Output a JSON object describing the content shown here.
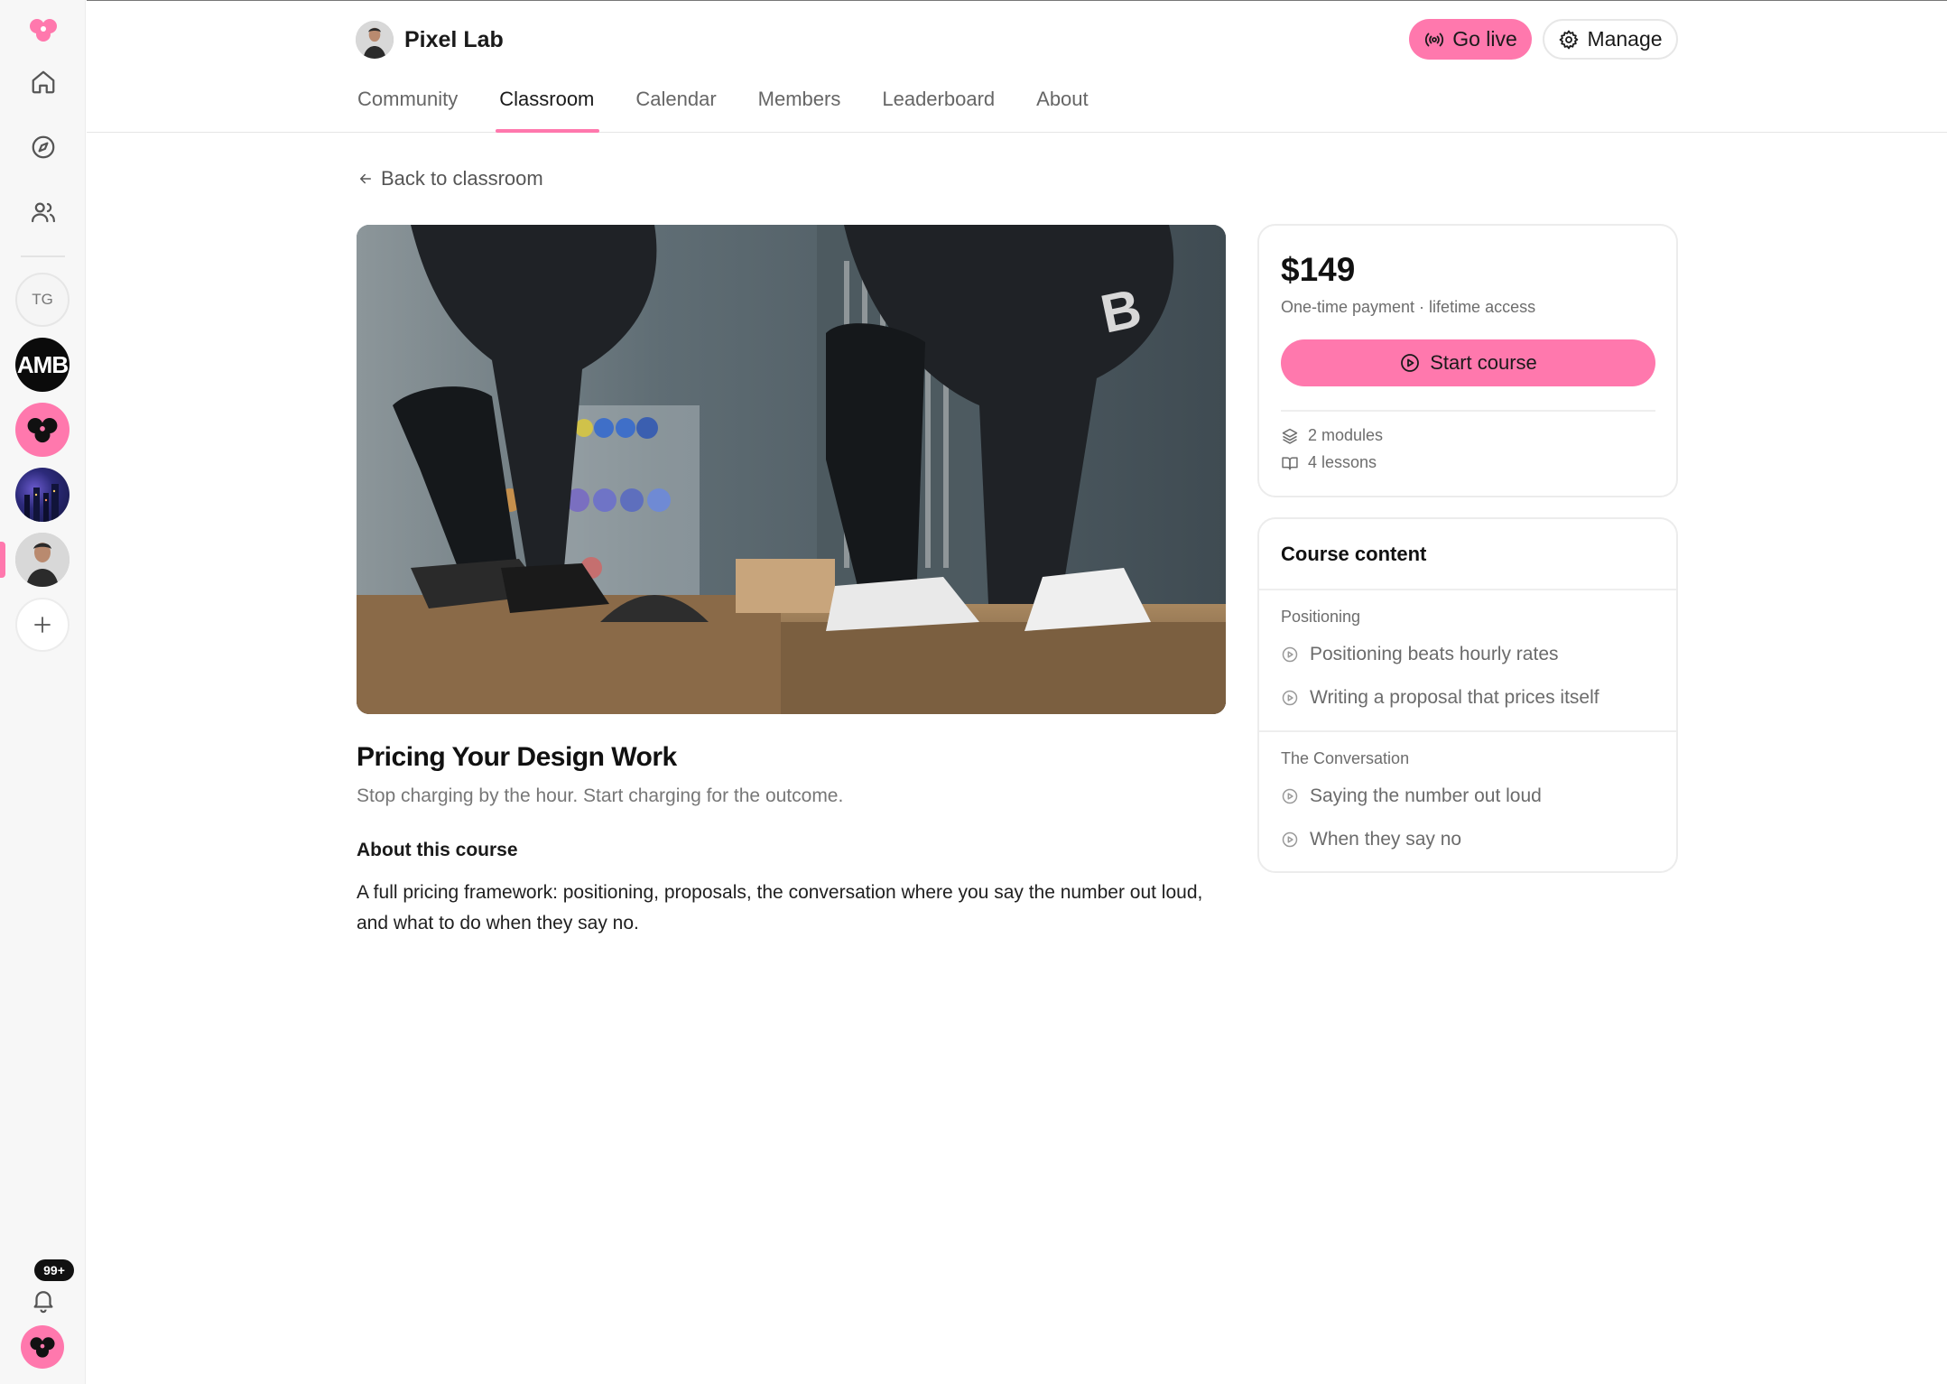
{
  "rail": {
    "servers": [
      {
        "initials": "TG"
      },
      {
        "initials": "AMB"
      }
    ],
    "notifications_badge": "99+"
  },
  "header": {
    "community_name": "Pixel Lab",
    "go_live_label": "Go live",
    "manage_label": "Manage",
    "tabs": [
      {
        "label": "Community"
      },
      {
        "label": "Classroom"
      },
      {
        "label": "Calendar"
      },
      {
        "label": "Members"
      },
      {
        "label": "Leaderboard"
      },
      {
        "label": "About"
      }
    ],
    "active_tab": "Classroom"
  },
  "main": {
    "back_label": "Back to classroom",
    "course": {
      "title": "Pricing Your Design Work",
      "subtitle": "Stop charging by the hour. Start charging for the outcome.",
      "about_heading": "About this course",
      "about_text": "A full pricing framework: positioning, proposals, the conversation where you say the number out loud, and what to do when they say no."
    }
  },
  "price_card": {
    "price": "$149",
    "note": "One-time payment · lifetime access",
    "start_label": "Start course",
    "modules": "2 modules",
    "lessons": "4 lessons"
  },
  "content_card": {
    "title": "Course content",
    "modules": [
      {
        "name": "Positioning",
        "lessons": [
          "Positioning beats hourly rates",
          "Writing a proposal that prices itself"
        ]
      },
      {
        "name": "The Conversation",
        "lessons": [
          "Saying the number out loud",
          "When they say no"
        ]
      }
    ]
  },
  "colors": {
    "accent": "#ff78ad",
    "text": "#1a1a1a",
    "muted": "#6d6d6d",
    "border": "#ececec"
  }
}
